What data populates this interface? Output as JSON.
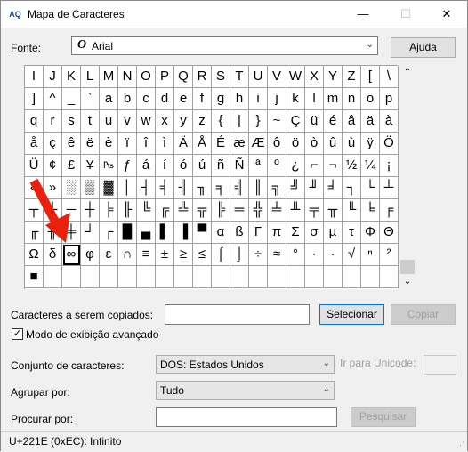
{
  "window": {
    "app_icon": "charmap-icon",
    "icon_text": "AQ",
    "title": "Mapa de Caracteres",
    "minimize": "—",
    "maximize": "☐",
    "close": "✕"
  },
  "font": {
    "label": "Fonte:",
    "icon": "O",
    "value": "Arial",
    "arrow": "⌄",
    "help_button": "Ajuda"
  },
  "grid": {
    "rows": [
      [
        "I",
        "J",
        "K",
        "L",
        "M",
        "N",
        "O",
        "P",
        "Q",
        "R",
        "S",
        "T",
        "U",
        "V",
        "W",
        "X",
        "Y",
        "Z",
        "[",
        "\\"
      ],
      [
        "]",
        "^",
        "_",
        "`",
        "a",
        "b",
        "c",
        "d",
        "e",
        "f",
        "g",
        "h",
        "i",
        "j",
        "k",
        "l",
        "m",
        "n",
        "o",
        "p"
      ],
      [
        "q",
        "r",
        "s",
        "t",
        "u",
        "v",
        "w",
        "x",
        "y",
        "z",
        "{",
        "|",
        "}",
        "~",
        "Ç",
        "ü",
        "é",
        "â",
        "ä",
        "à"
      ],
      [
        "å",
        "ç",
        "ê",
        "ë",
        "è",
        "ï",
        "î",
        "ì",
        "Ä",
        "Å",
        "É",
        "æ",
        "Æ",
        "ô",
        "ö",
        "ò",
        "û",
        "ù",
        "ÿ",
        "Ö"
      ],
      [
        "Ü",
        "¢",
        "£",
        "¥",
        "₧",
        "ƒ",
        "á",
        "í",
        "ó",
        "ú",
        "ñ",
        "Ñ",
        "ª",
        "º",
        "¿",
        "⌐",
        "¬",
        "½",
        "¼",
        "¡"
      ],
      [
        "«",
        "»",
        "░",
        "▒",
        "▓",
        "│",
        "┤",
        "╡",
        "╢",
        "╖",
        "╕",
        "╣",
        "║",
        "╗",
        "╝",
        "╜",
        "╛",
        "┐",
        "└",
        "┴"
      ],
      [
        "┬",
        "├",
        "─",
        "┼",
        "╞",
        "╟",
        "╚",
        "╔",
        "╩",
        "╦",
        "╠",
        "═",
        "╬",
        "╧",
        "╨",
        "╤",
        "╥",
        "╙",
        "╘",
        "╒"
      ],
      [
        "╓",
        "╫",
        "╪",
        "┘",
        "┌",
        "█",
        "▄",
        "▌",
        "▐",
        "▀",
        "α",
        "ß",
        "Γ",
        "π",
        "Σ",
        "σ",
        "µ",
        "τ",
        "Φ",
        "Θ"
      ],
      [
        "Ω",
        "δ",
        "∞",
        "φ",
        "ε",
        "∩",
        "≡",
        "±",
        "≥",
        "≤",
        "⌠",
        "⌡",
        "÷",
        "≈",
        "°",
        "∙",
        "·",
        "√",
        "ⁿ",
        "²"
      ],
      [
        "■",
        "",
        "",
        "",
        "",
        "",
        "",
        "",
        "",
        "",
        "",
        "",
        "",
        "",
        "",
        "",
        "",
        "",
        "",
        ""
      ]
    ],
    "selected_row": 8,
    "selected_col": 2
  },
  "scrollbar": {
    "up": "⌃",
    "down": "⌄"
  },
  "copy": {
    "label": "Caracteres a serem copiados:",
    "value": "",
    "select_button": "Selecionar",
    "copy_button": "Copiar"
  },
  "advanced": {
    "checked": "✓",
    "label": "Modo de exibição avançado"
  },
  "charset": {
    "label": "Conjunto de caracteres:",
    "value": "DOS: Estados Unidos",
    "arrow": "⌄",
    "goto_unicode_label": "Ir para Unicode:",
    "goto_unicode_value": ""
  },
  "group_by": {
    "label": "Agrupar por:",
    "value": "Tudo",
    "arrow": "⌄"
  },
  "search": {
    "label": "Procurar por:",
    "value": "",
    "button": "Pesquisar"
  },
  "status": {
    "text": "U+221E (0xEC): Infinito"
  },
  "annotation": {
    "color": "#e8200c"
  }
}
